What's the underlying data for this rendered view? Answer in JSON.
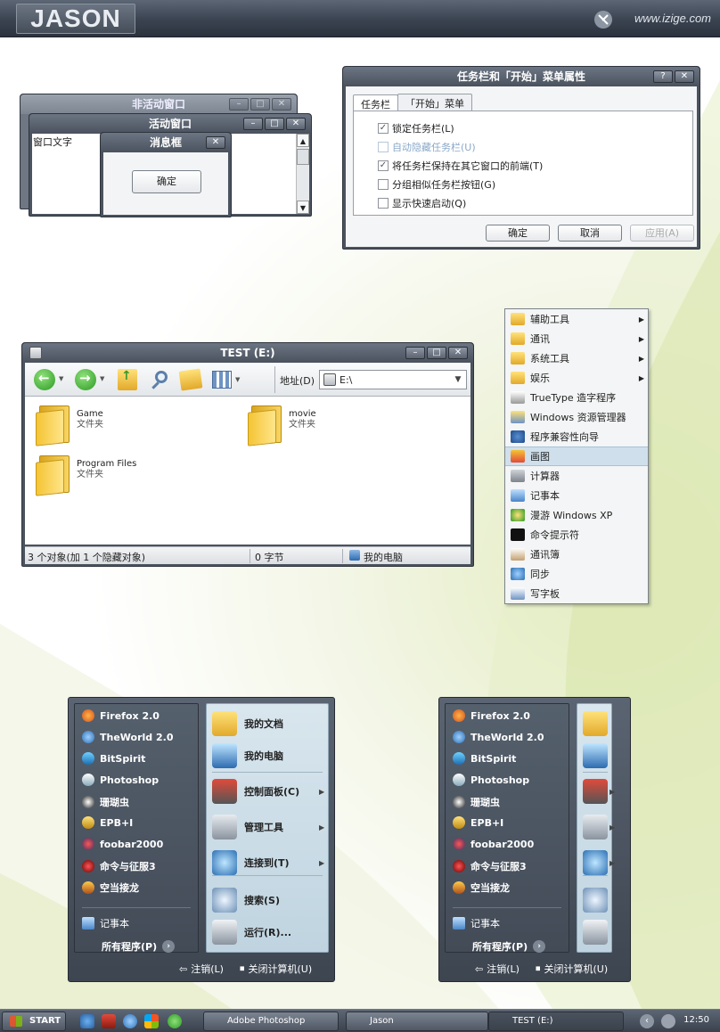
{
  "header": {
    "logo": "JASON",
    "site": "www.izige.com"
  },
  "demo_windows": {
    "inactive_title": "非活动窗口",
    "active_title": "活动窗口",
    "active_text": "窗口文字",
    "msgbox_title": "消息框",
    "msgbox_ok": "确定"
  },
  "taskbar_dialog": {
    "title": "任务栏和「开始」菜单属性",
    "tabs": [
      "任务栏",
      "「开始」菜单"
    ],
    "options": [
      {
        "label": "锁定任务栏(L)",
        "checked": true,
        "enabled": true
      },
      {
        "label": "自动隐藏任务栏(U)",
        "checked": false,
        "enabled": false
      },
      {
        "label": "将任务栏保持在其它窗口的前端(T)",
        "checked": true,
        "enabled": true
      },
      {
        "label": "分组相似任务栏按钮(G)",
        "checked": false,
        "enabled": true
      },
      {
        "label": "显示快速启动(Q)",
        "checked": false,
        "enabled": true
      }
    ],
    "buttons": {
      "ok": "确定",
      "cancel": "取消",
      "apply": "应用(A)"
    }
  },
  "explorer": {
    "title": "TEST (E:)",
    "address_label": "地址(D)",
    "address_value": "E:\\",
    "files": [
      {
        "name": "Game",
        "type": "文件夹"
      },
      {
        "name": "movie",
        "type": "文件夹"
      },
      {
        "name": "Program Files",
        "type": "文件夹"
      }
    ],
    "status": {
      "objects": "3 个对象(加 1 个隐藏对象)",
      "size": "0 字节",
      "location": "我的电脑"
    }
  },
  "context_menu": {
    "items": [
      {
        "label": "辅助工具",
        "submenu": true,
        "icon": "folder-icon"
      },
      {
        "label": "通讯",
        "submenu": true,
        "icon": "folder-icon"
      },
      {
        "label": "系统工具",
        "submenu": true,
        "icon": "folder-icon"
      },
      {
        "label": "娱乐",
        "submenu": true,
        "icon": "folder-icon"
      },
      {
        "label": "TrueType 造字程序",
        "submenu": false,
        "icon": "font-editor-icon"
      },
      {
        "label": "Windows 资源管理器",
        "submenu": false,
        "icon": "explorer-icon"
      },
      {
        "label": "程序兼容性向导",
        "submenu": false,
        "icon": "help-icon"
      },
      {
        "label": "画图",
        "submenu": false,
        "icon": "paint-icon",
        "selected": true
      },
      {
        "label": "计算器",
        "submenu": false,
        "icon": "calculator-icon"
      },
      {
        "label": "记事本",
        "submenu": false,
        "icon": "notepad-icon"
      },
      {
        "label": "漫游 Windows XP",
        "submenu": false,
        "icon": "tour-icon"
      },
      {
        "label": "命令提示符",
        "submenu": false,
        "icon": "cmd-icon"
      },
      {
        "label": "通讯簿",
        "submenu": false,
        "icon": "address-book-icon"
      },
      {
        "label": "同步",
        "submenu": false,
        "icon": "sync-icon"
      },
      {
        "label": "写字板",
        "submenu": false,
        "icon": "wordpad-icon"
      }
    ]
  },
  "start_menu": {
    "programs": [
      {
        "label": "Firefox 2.0",
        "icon": "firefox-icon"
      },
      {
        "label": "TheWorld 2.0",
        "icon": "theworld-icon"
      },
      {
        "label": "BitSpirit",
        "icon": "bitspirit-icon"
      },
      {
        "label": "Photoshop",
        "icon": "photoshop-icon"
      },
      {
        "label": "珊瑚虫",
        "icon": "qq-icon"
      },
      {
        "label": "EPB+I",
        "icon": "epb-icon"
      },
      {
        "label": "foobar2000",
        "icon": "foobar-icon"
      },
      {
        "label": "命令与征服3",
        "icon": "cnc-icon"
      },
      {
        "label": "空当接龙",
        "icon": "freecell-icon"
      }
    ],
    "notepad": "记事本",
    "all_programs": "所有程序(P)",
    "places": [
      {
        "label": "我的文档",
        "icon": "documents-icon",
        "submenu": false
      },
      {
        "label": "我的电脑",
        "icon": "computer-icon",
        "submenu": false
      },
      {
        "label": "控制面板(C)",
        "icon": "tools-icon",
        "submenu": true
      },
      {
        "label": "管理工具",
        "icon": "lock-icon",
        "submenu": true
      },
      {
        "label": "连接到(T)",
        "icon": "network-icon",
        "submenu": true
      },
      {
        "label": "搜索(S)",
        "icon": "search-icon",
        "submenu": false
      },
      {
        "label": "运行(R)...",
        "icon": "run-icon",
        "submenu": false
      }
    ],
    "logoff": "注销(L)",
    "shutdown": "关闭计算机(U)"
  },
  "taskbar": {
    "start": "START",
    "tasks": [
      "Adobe Photoshop",
      "Jason",
      "TEST (E:)"
    ],
    "clock": "12:50"
  },
  "colors": {
    "chrome_dark": "#3d4550",
    "chrome_light": "#6c7583",
    "accent_blue": "#bfd4e0",
    "folder": "#f4c434"
  }
}
